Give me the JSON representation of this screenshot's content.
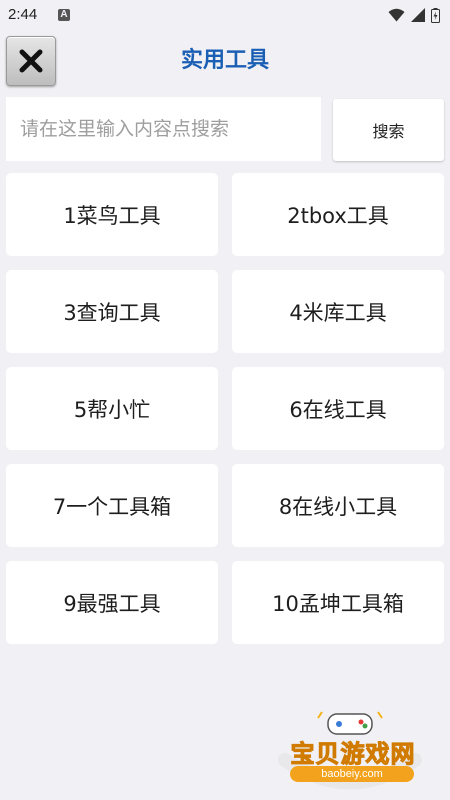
{
  "status_bar": {
    "time": "2:44",
    "notification_icon_letter": "A",
    "icons": [
      "wifi-icon",
      "signal-icon",
      "battery-icon"
    ]
  },
  "header": {
    "title": "实用工具",
    "close_icon": "close-icon",
    "title_color": "#1a5fb4"
  },
  "search": {
    "placeholder": "请在这里输入内容点搜索",
    "value": "",
    "button_label": "搜索"
  },
  "tools": [
    {
      "label": "1菜鸟工具"
    },
    {
      "label": "2tbox工具"
    },
    {
      "label": "3查询工具"
    },
    {
      "label": "4米库工具"
    },
    {
      "label": "5帮小忙"
    },
    {
      "label": "6在线工具"
    },
    {
      "label": "7一个工具箱"
    },
    {
      "label": "8在线小工具"
    },
    {
      "label": "9最强工具"
    },
    {
      "label": "10孟坤工具箱"
    }
  ],
  "watermark": {
    "brand": "宝贝游戏网",
    "domain": "baobeiy.com",
    "icon": "gamepad-icon"
  }
}
